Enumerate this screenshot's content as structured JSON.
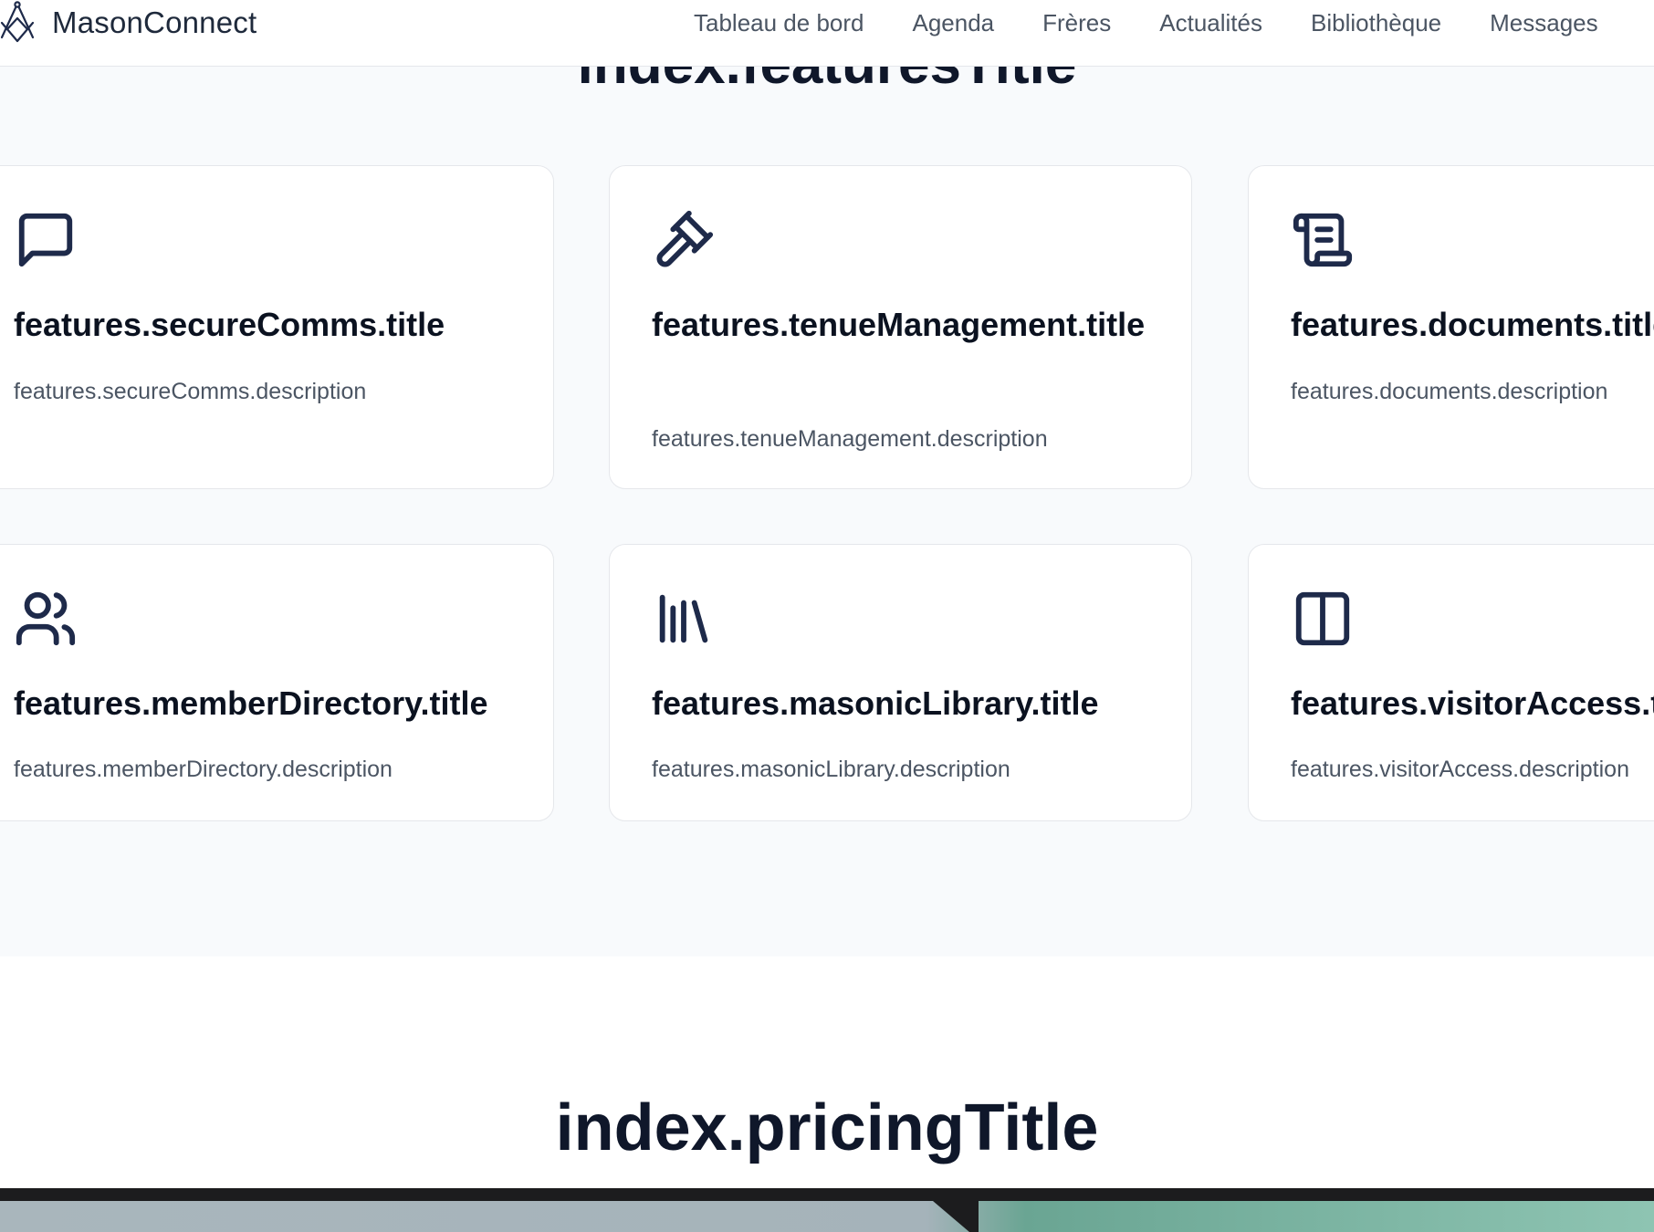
{
  "header": {
    "brand_name": "MasonConnect",
    "nav": [
      {
        "label": "Tableau de bord"
      },
      {
        "label": "Agenda"
      },
      {
        "label": "Frères"
      },
      {
        "label": "Actualités"
      },
      {
        "label": "Bibliothèque"
      },
      {
        "label": "Messages"
      }
    ]
  },
  "features": {
    "title": "index.featuresTitle",
    "cards": [
      {
        "icon": "message-square-icon",
        "title": "features.secureComms.title",
        "description": "features.secureComms.description"
      },
      {
        "icon": "gavel-icon",
        "title": "features.tenueManagement.title",
        "description": "features.tenueManagement.description"
      },
      {
        "icon": "scroll-icon",
        "title": "features.documents.title",
        "description": "features.documents.description"
      },
      {
        "icon": "users-icon",
        "title": "features.memberDirectory.title",
        "description": "features.memberDirectory.description"
      },
      {
        "icon": "library-icon",
        "title": "features.masonicLibrary.title",
        "description": "features.masonicLibrary.description"
      },
      {
        "icon": "columns-icon",
        "title": "features.visitorAccess.title",
        "description": "features.visitorAccess.description"
      }
    ]
  },
  "pricing": {
    "title": "index.pricingTitle"
  },
  "colors": {
    "icon": "#1e2a4a",
    "section_bg": "#f8fafc",
    "text_primary": "#0f172a",
    "text_muted": "#4b5563"
  }
}
